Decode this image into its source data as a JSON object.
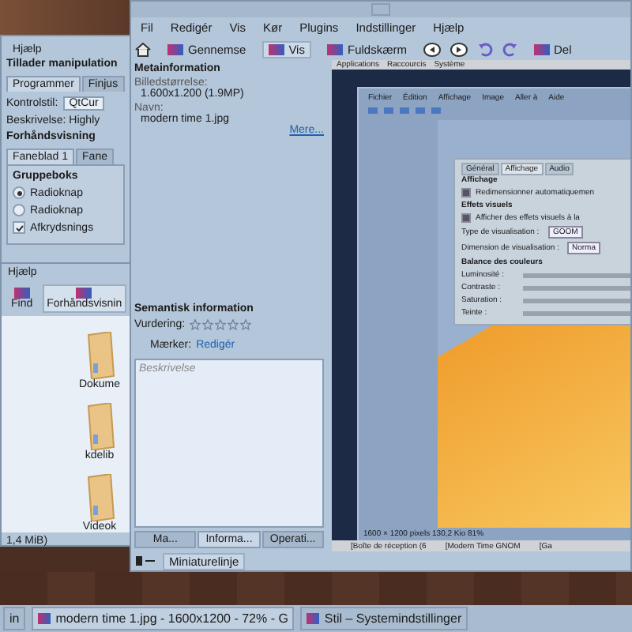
{
  "settings_window": {
    "menu": [
      "Hjælp"
    ],
    "heading": "Tillader manipulation",
    "tabs": [
      {
        "label": "Programmer",
        "selected": true
      },
      {
        "label": "Finjus",
        "selected": false
      }
    ],
    "style_label": "Kontrolstil:",
    "style_value": "QtCur",
    "description": "Beskrivelse: Highly",
    "preview_heading": "Forhåndsvisning",
    "preview_tabs": [
      {
        "label": "Faneblad 1",
        "selected": true
      },
      {
        "label": "Fane",
        "selected": false
      }
    ],
    "group_title": "Gruppeboks",
    "controls": [
      {
        "kind": "radio",
        "label": "Radioknap",
        "checked": true
      },
      {
        "kind": "radio",
        "label": "Radioknap",
        "checked": false
      },
      {
        "kind": "checkbox",
        "label": "Afkrydsnings",
        "checked": true
      }
    ]
  },
  "file_manager": {
    "menu": [
      "Hjælp"
    ],
    "toolbar": [
      {
        "label": "Find",
        "selected": false
      },
      {
        "label": "Forhåndsvisnin",
        "selected": true
      }
    ],
    "folders": [
      "Dokume",
      "kdelib",
      "Videok"
    ],
    "status": "1,4 MiB)"
  },
  "viewer": {
    "menu": [
      "Fil",
      "Redigér",
      "Vis",
      "Kør",
      "Plugins",
      "Indstillinger",
      "Hjælp"
    ],
    "toolbar": [
      {
        "label": "Gennemse",
        "selected": false
      },
      {
        "label": "Vis",
        "selected": true
      },
      {
        "label": "Fuldskærm",
        "selected": false
      },
      {
        "label": "Del",
        "selected": false
      }
    ],
    "sidebar": {
      "meta_heading": "Metainformation",
      "fields": [
        {
          "label": "Billedstørrelse:",
          "value": "1.600x1.200 (1.9MP)"
        },
        {
          "label": "Navn:",
          "value": "modern time 1.jpg"
        }
      ],
      "more_link": "Mere...",
      "semantic_heading": "Semantisk information",
      "rating_label": "Vurdering:",
      "stars": 0,
      "tags_label": "Mærker:",
      "tags_link": "Redigér",
      "description_placeholder": "Beskrivelse",
      "tabs": [
        {
          "label": "Ma...",
          "selected": false
        },
        {
          "label": "Informa...",
          "selected": true
        },
        {
          "label": "Operati...",
          "selected": false
        }
      ]
    },
    "image": {
      "panel_menu": [
        "Applications",
        "Raccourcis",
        "Système"
      ],
      "eog_menu": [
        "Fichier",
        "Édition",
        "Affichage",
        "Image",
        "Aller à",
        "Aide"
      ],
      "dialog": {
        "tabs": [
          {
            "label": "Général",
            "selected": false
          },
          {
            "label": "Affichage",
            "selected": true
          },
          {
            "label": "Audio",
            "selected": false
          }
        ],
        "display_heading": "Affichage",
        "resize_option": "Redimensionner automatiquemen",
        "resize_checked": true,
        "effects_heading": "Effets visuels",
        "effects_option": "Afficher des effets visuels à la",
        "effects_checked": true,
        "type_label": "Type de visualisation :",
        "type_value": "GOOM",
        "size_label": "Dimension de visualisation :",
        "size_value": "Norma",
        "balance_heading": "Balance des couleurs",
        "balance": [
          {
            "label": "Luminosité :"
          },
          {
            "label": "Contraste :"
          },
          {
            "label": "Saturation :"
          },
          {
            "label": "Teinte :"
          }
        ]
      },
      "eog_status": "1600 × 1200 pixels  130,2 Kio  81%",
      "bottom_panel": [
        "[Boîte de réception (6",
        "[Modern Time GNOM",
        "[Ga"
      ]
    },
    "thumbnail_button": "Miniaturelinje"
  },
  "taskbar": [
    {
      "label": "in",
      "selected": false
    },
    {
      "label": "modern time 1.jpg - 1600x1200 - 72% - G",
      "selected": true
    },
    {
      "label": "Stil – Systemindstillinger",
      "selected": false
    }
  ]
}
